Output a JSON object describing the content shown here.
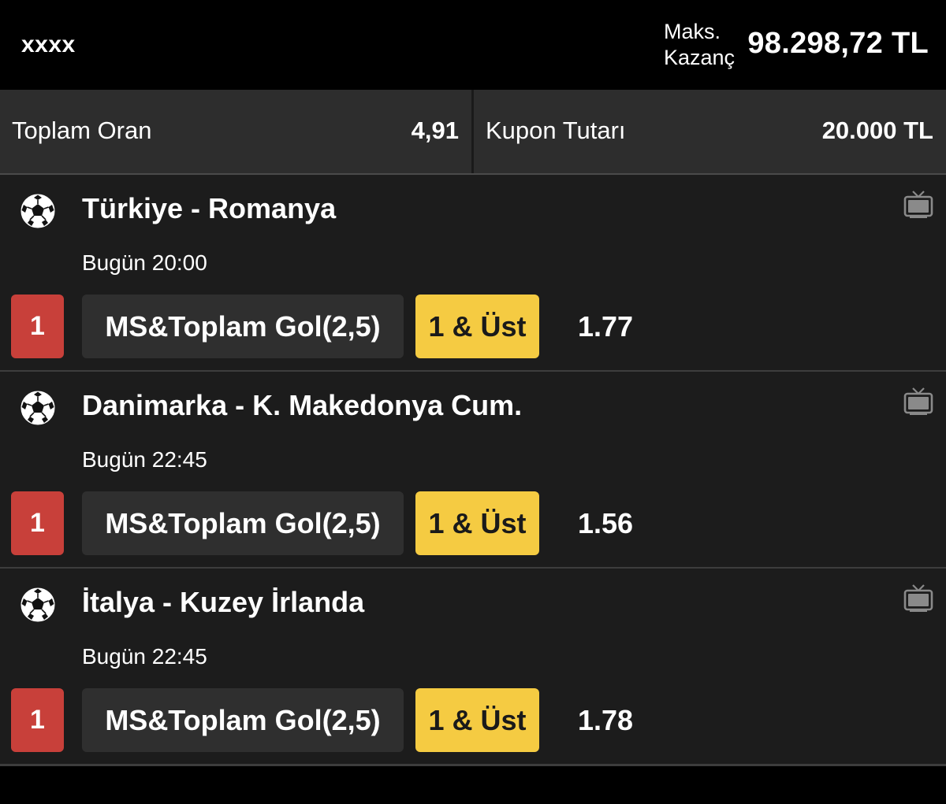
{
  "header": {
    "username": "xxxx",
    "max_win_label_line1": "Maks.",
    "max_win_label_line2": "Kazanç",
    "max_win_value": "98.298,72 TL"
  },
  "summary": {
    "total_odds_label": "Toplam Oran",
    "total_odds_value": "4,91",
    "stake_label": "Kupon Tutarı",
    "stake_value": "20.000 TL"
  },
  "icons": {
    "sport": "soccer-ball-icon",
    "live": "tv-icon"
  },
  "colors": {
    "position_badge": "#c8403a",
    "pick_badge": "#f5cb42"
  },
  "matches": [
    {
      "teams": "Türkiye - Romanya",
      "time": "Bugün 20:00",
      "position": "1",
      "market": "MS&Toplam Gol(2,5)",
      "pick": "1 & Üst",
      "odd": "1.77"
    },
    {
      "teams": "Danimarka - K. Makedonya Cum.",
      "time": "Bugün 22:45",
      "position": "1",
      "market": "MS&Toplam Gol(2,5)",
      "pick": "1 & Üst",
      "odd": "1.56"
    },
    {
      "teams": "İtalya - Kuzey İrlanda",
      "time": "Bugün 22:45",
      "position": "1",
      "market": "MS&Toplam Gol(2,5)",
      "pick": "1 & Üst",
      "odd": "1.78"
    }
  ]
}
